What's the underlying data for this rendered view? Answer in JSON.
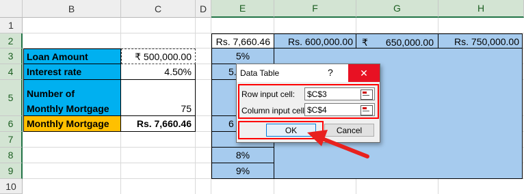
{
  "columns": [
    "B",
    "C",
    "D",
    "E",
    "F",
    "G",
    "H"
  ],
  "rows": [
    "1",
    "2",
    "3",
    "4",
    "5",
    "6",
    "7",
    "8",
    "9",
    "10"
  ],
  "cells": {
    "b3": "Loan Amount",
    "c3": "₹ 500,000.00",
    "b4": "Interest rate",
    "c4": "4.50%",
    "b5_line1": "Number of",
    "b5_line2": "Monthly Mortgage",
    "c5": "75",
    "b6": "Monthly Mortgage",
    "c6": "Rs. 7,660.46",
    "e2": "Rs. 7,660.46",
    "f2": "Rs. 600,000.00",
    "g2_symbol": "₹",
    "g2_value": "650,000.00",
    "h2": "Rs. 750,000.00",
    "e3": "5%",
    "e4_partial": "5.",
    "e6_partial": "6",
    "e8": "8%",
    "e9": "9%"
  },
  "dialog": {
    "title": "Data Table",
    "help": "?",
    "close": "✕",
    "row_label": "Row input cell:",
    "row_value": "$C$3",
    "col_label": "Column input cell:",
    "col_value": "$C$4",
    "ok": "OK",
    "cancel": "Cancel"
  },
  "colors": {
    "blue_fill": "#00b0f0",
    "orange_fill": "#ffc000",
    "table_fill": "#a6cbee",
    "highlight_red": "#ff0000",
    "close_red": "#e81123"
  }
}
